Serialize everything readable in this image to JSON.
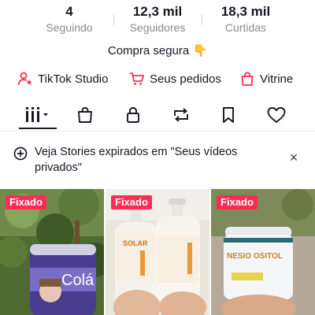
{
  "stats": [
    {
      "value": "4",
      "label": "Seguindo"
    },
    {
      "value": "12,3 mil",
      "label": "Seguidores"
    },
    {
      "value": "18,3 mil",
      "label": "Curtidas"
    }
  ],
  "bio": {
    "text": "Compra segura",
    "emoji": "👇"
  },
  "links": [
    {
      "label": "TikTok Studio",
      "icon": "person-star-icon"
    },
    {
      "label": "Seus pedidos",
      "icon": "cart-icon"
    },
    {
      "label": "Vitrine",
      "icon": "shopping-bag-icon"
    }
  ],
  "tabs": [
    {
      "name": "videos",
      "icon": "grid-lines-icon",
      "active": true
    },
    {
      "name": "shop",
      "icon": "bag-icon"
    },
    {
      "name": "private",
      "icon": "lock-icon"
    },
    {
      "name": "reposts",
      "icon": "repost-icon"
    },
    {
      "name": "favorites",
      "icon": "bookmark-icon"
    },
    {
      "name": "liked",
      "icon": "heart-icon"
    }
  ],
  "notice": {
    "text": "Veja Stories expirados em \"Seus vídeos privados\"",
    "close": "×"
  },
  "videos": [
    {
      "badge": "Fixado",
      "product_text": "Colá"
    },
    {
      "badge": "Fixado",
      "product_text": "SOLAR"
    },
    {
      "badge": "Fixado",
      "product_text": "NESIO OSITOL"
    }
  ],
  "colors": {
    "accent": "#fe2c55",
    "text": "#161823",
    "muted": "#8a8b91"
  }
}
